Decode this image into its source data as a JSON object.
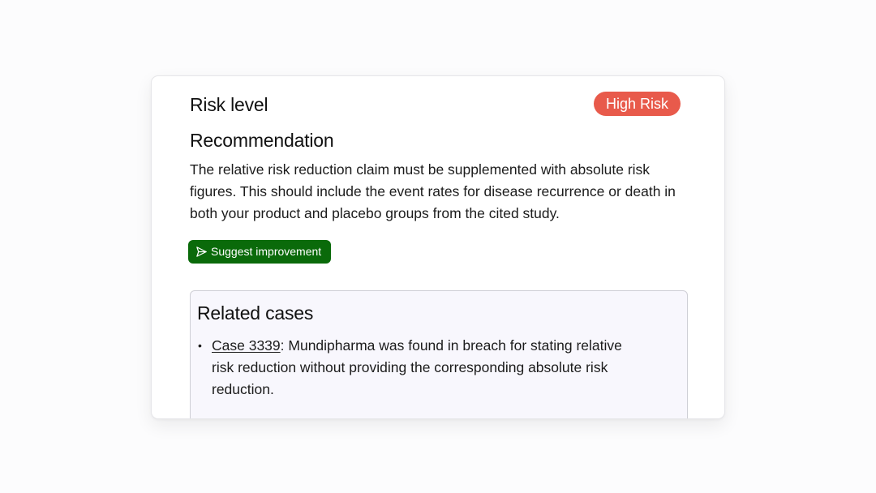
{
  "risk": {
    "title": "Risk level",
    "badge_label": "High Risk",
    "badge_color": "#e85a4b"
  },
  "recommendation": {
    "title": "Recommendation",
    "text": "The relative risk reduction claim must be supplemented with absolute risk figures. This should include the event rates for disease recurrence or death in both your product and placebo groups from the cited study."
  },
  "actions": {
    "suggest_label": "Suggest improvement",
    "suggest_icon": "send-icon",
    "suggest_color": "#0a6a0a"
  },
  "related": {
    "title": "Related cases",
    "cases": [
      {
        "link": "Case 3339",
        "description": ": Mundipharma was found in breach for stating relative risk reduction without providing the corresponding absolute risk reduction."
      }
    ]
  }
}
